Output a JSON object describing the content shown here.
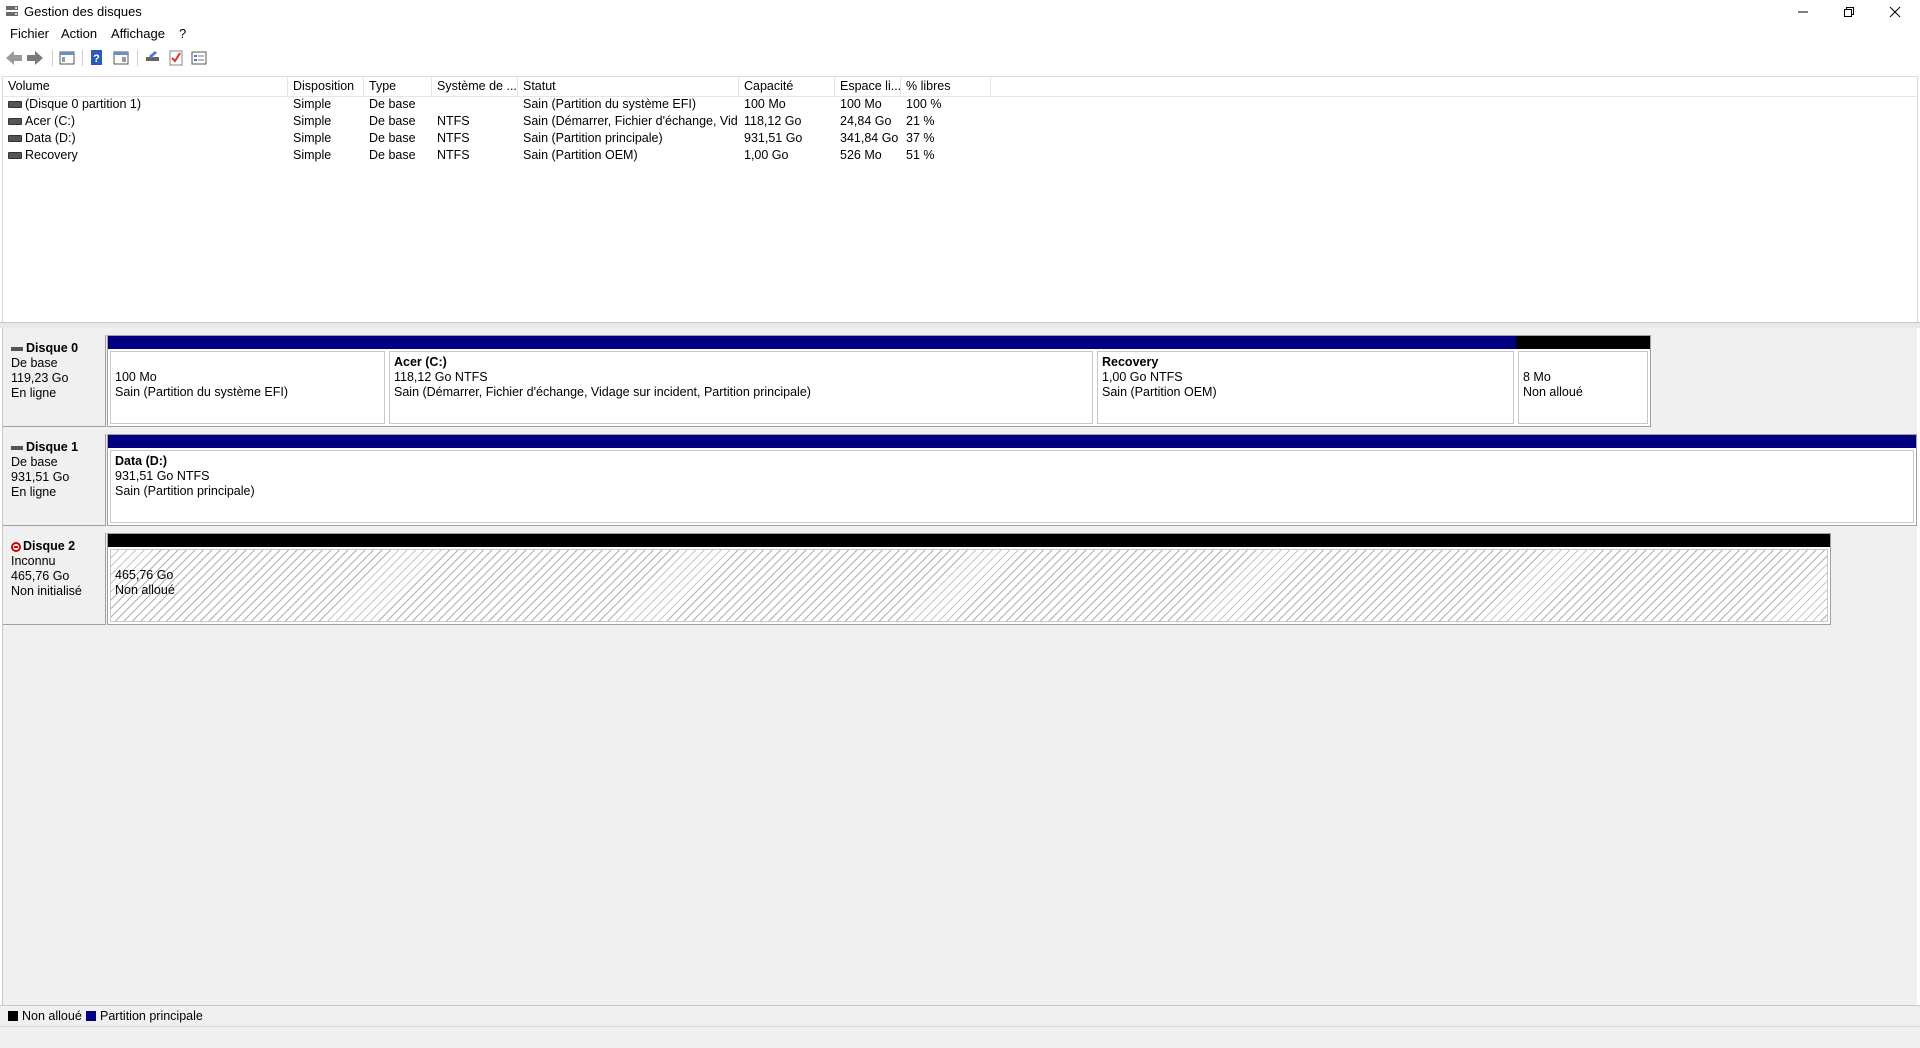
{
  "window": {
    "title": "Gestion des disques"
  },
  "menu": [
    "Fichier",
    "Action",
    "Affichage",
    "?"
  ],
  "toolbar_icons": [
    "back-icon",
    "forward-icon",
    "show-hide-console-tree-icon",
    "help-icon",
    "properties-icon",
    "rescan-icon",
    "check-icon",
    "details-icon"
  ],
  "list": {
    "columns": [
      "Volume",
      "Disposition",
      "Type",
      "Système de ...",
      "Statut",
      "Capacité",
      "Espace li...",
      "% libres"
    ],
    "rows": [
      [
        "(Disque 0 partition 1)",
        "Simple",
        "De base",
        "",
        "Sain (Partition du système EFI)",
        "100 Mo",
        "100 Mo",
        "100 %"
      ],
      [
        "Acer (C:)",
        "Simple",
        "De base",
        "NTFS",
        "Sain (Démarrer, Fichier d'échange, Vid...",
        "118,12 Go",
        "24,84 Go",
        "21 %"
      ],
      [
        "Data (D:)",
        "Simple",
        "De base",
        "NTFS",
        "Sain (Partition principale)",
        "931,51 Go",
        "341,84 Go",
        "37 %"
      ],
      [
        "Recovery",
        "Simple",
        "De base",
        "NTFS",
        "Sain (Partition OEM)",
        "1,00 Go",
        "526 Mo",
        "51 %"
      ]
    ]
  },
  "disks": [
    {
      "name": "Disque 0",
      "type": "De base",
      "size": "119,23 Go",
      "status": "En ligne",
      "partitions": [
        {
          "name": "",
          "size": "100 Mo",
          "status": "Sain (Partition du système EFI)",
          "kind": "primary"
        },
        {
          "name": "Acer  (C:)",
          "size": "118,12 Go NTFS",
          "status": "Sain (Démarrer, Fichier d'échange, Vidage sur incident, Partition principale)",
          "kind": "primary"
        },
        {
          "name": "Recovery",
          "size": "1,00 Go NTFS",
          "status": "Sain (Partition OEM)",
          "kind": "primary"
        },
        {
          "name": "",
          "size": "8 Mo",
          "status": "Non alloué",
          "kind": "unallocated"
        }
      ]
    },
    {
      "name": "Disque 1",
      "type": "De base",
      "size": "931,51 Go",
      "status": "En ligne",
      "partitions": [
        {
          "name": "Data  (D:)",
          "size": "931,51 Go NTFS",
          "status": "Sain (Partition principale)",
          "kind": "primary"
        }
      ]
    },
    {
      "name": "Disque 2",
      "type": "Inconnu",
      "size": "465,76 Go",
      "status": "Non initialisé",
      "partitions": [
        {
          "name": "",
          "size": "465,76 Go",
          "status": "Non alloué",
          "kind": "unallocated"
        }
      ]
    }
  ],
  "legend": [
    {
      "label": "Non alloué",
      "color": "#000000"
    },
    {
      "label": "Partition principale",
      "color": "#000080"
    }
  ],
  "colors": {
    "primary": "#000080",
    "unallocated": "#000000"
  }
}
